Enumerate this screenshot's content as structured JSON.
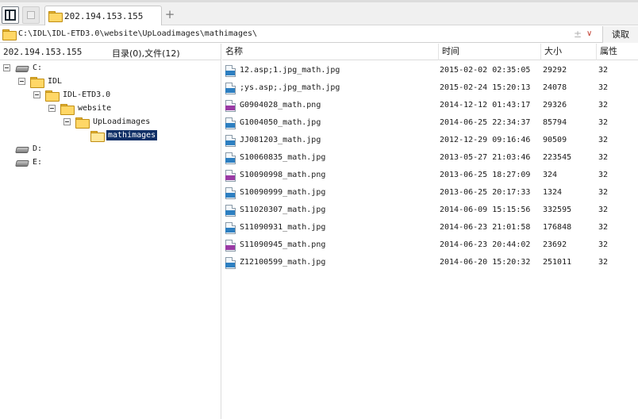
{
  "tabbar": {
    "active_tab_label": "202.194.153.155",
    "new_tab_symbol": "+"
  },
  "address": {
    "path": "C:\\IDL\\IDL-ETD3.0\\website\\UpLoadimages\\mathimages\\",
    "pin_symbol": "±",
    "dropdown_symbol": "∨",
    "read_label": "读取"
  },
  "left": {
    "host": "202.194.153.155",
    "summary": "目录(0),文件(12)",
    "tree": [
      {
        "label": "C:",
        "type": "drive",
        "expanded": true,
        "depth": 0
      },
      {
        "label": "IDL",
        "type": "folder",
        "expanded": true,
        "depth": 1
      },
      {
        "label": "IDL-ETD3.0",
        "type": "folder",
        "expanded": true,
        "depth": 2
      },
      {
        "label": "website",
        "type": "folder",
        "expanded": true,
        "depth": 3
      },
      {
        "label": "UpLoadimages",
        "type": "folder",
        "expanded": true,
        "depth": 4
      },
      {
        "label": "mathimages",
        "type": "folder",
        "expanded": false,
        "depth": 5,
        "selected": true
      },
      {
        "label": "D:",
        "type": "drive",
        "expanded": false,
        "depth": 0
      },
      {
        "label": "E:",
        "type": "drive",
        "expanded": false,
        "depth": 0
      }
    ]
  },
  "list": {
    "columns": {
      "name": "名称",
      "time": "时间",
      "size": "大小",
      "attr": "属性"
    },
    "files": [
      {
        "name": "12.asp;1.jpg_math.jpg",
        "time": "2015-02-02 02:35:05",
        "size": "29292",
        "attr": "32",
        "kind": "jpg"
      },
      {
        "name": ";ys.asp;.jpg_math.jpg",
        "time": "2015-02-24 15:20:13",
        "size": "24078",
        "attr": "32",
        "kind": "jpg"
      },
      {
        "name": "G0904028_math.png",
        "time": "2014-12-12 01:43:17",
        "size": "29326",
        "attr": "32",
        "kind": "png"
      },
      {
        "name": "G1004050_math.jpg",
        "time": "2014-06-25 22:34:37",
        "size": "85794",
        "attr": "32",
        "kind": "jpg"
      },
      {
        "name": "JJ081203_math.jpg",
        "time": "2012-12-29 09:16:46",
        "size": "90509",
        "attr": "32",
        "kind": "jpg"
      },
      {
        "name": "S10060835_math.jpg",
        "time": "2013-05-27 21:03:46",
        "size": "223545",
        "attr": "32",
        "kind": "jpg"
      },
      {
        "name": "S10090998_math.png",
        "time": "2013-06-25 18:27:09",
        "size": "324",
        "attr": "32",
        "kind": "png"
      },
      {
        "name": "S10090999_math.jpg",
        "time": "2013-06-25 20:17:33",
        "size": "1324",
        "attr": "32",
        "kind": "jpg"
      },
      {
        "name": "S11020307_math.jpg",
        "time": "2014-06-09 15:15:56",
        "size": "332595",
        "attr": "32",
        "kind": "jpg"
      },
      {
        "name": "S11090931_math.jpg",
        "time": "2014-06-23 21:01:58",
        "size": "176848",
        "attr": "32",
        "kind": "jpg"
      },
      {
        "name": "S11090945_math.png",
        "time": "2014-06-23 20:44:02",
        "size": "23692",
        "attr": "32",
        "kind": "png"
      },
      {
        "name": "Z12100599_math.jpg",
        "time": "2014-06-20 15:20:32",
        "size": "251011",
        "attr": "32",
        "kind": "jpg"
      }
    ]
  },
  "icons": {
    "panel_toggle": "panel-toggle-icon",
    "folder": "folder-icon",
    "drive": "drive-icon",
    "jpg_file": "jpg-file-icon",
    "png_file": "png-file-icon"
  },
  "colors": {
    "selection": "#0f2f66",
    "jpg_badge": "#2d7fc1",
    "png_badge": "#9a3aa5",
    "folder": "#ffd766",
    "dropdown": "#c0392b"
  }
}
